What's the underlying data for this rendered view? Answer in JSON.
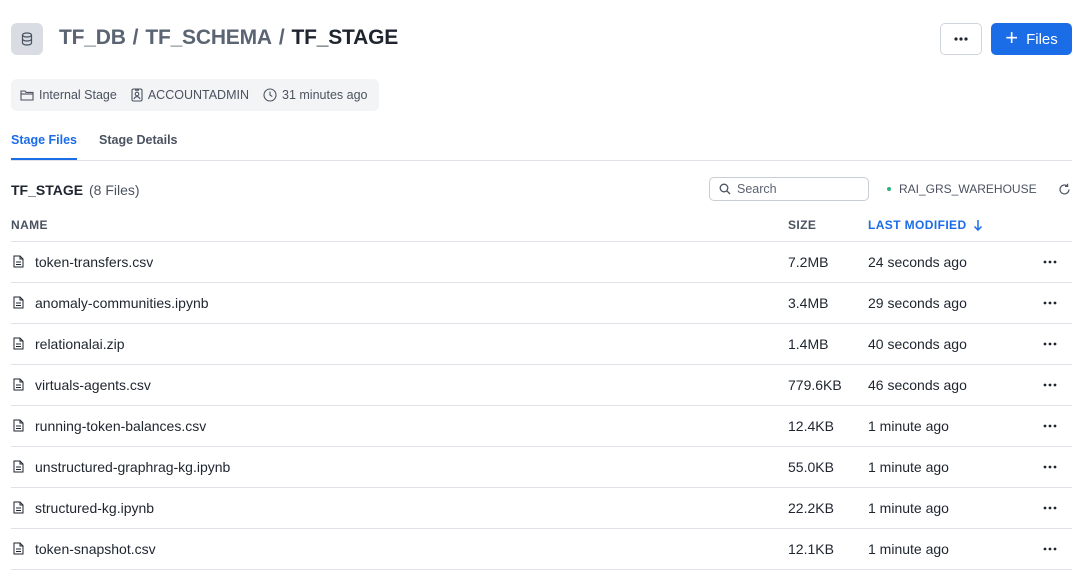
{
  "header": {
    "breadcrumb": [
      "TF_DB",
      "TF_SCHEMA",
      "TF_STAGE"
    ],
    "separator": "/",
    "files_button_label": "Files",
    "more_button_icon": "ellipsis-icon",
    "db_icon": "database-icon"
  },
  "meta": {
    "stage_type": "Internal Stage",
    "owner": "ACCOUNTADMIN",
    "created": "31 minutes ago"
  },
  "tabs": [
    {
      "label": "Stage Files",
      "active": true
    },
    {
      "label": "Stage Details",
      "active": false
    }
  ],
  "toolbar": {
    "title": "TF_STAGE",
    "count": "(8 Files)",
    "search_placeholder": "Search",
    "warehouse": "RAI_GRS_WAREHOUSE"
  },
  "table": {
    "columns": {
      "name": "NAME",
      "size": "SIZE",
      "modified": "LAST MODIFIED"
    },
    "rows": [
      {
        "name": "token-transfers.csv",
        "size": "7.2MB",
        "modified": "24 seconds ago"
      },
      {
        "name": "anomaly-communities.ipynb",
        "size": "3.4MB",
        "modified": "29 seconds ago"
      },
      {
        "name": "relationalai.zip",
        "size": "1.4MB",
        "modified": "40 seconds ago"
      },
      {
        "name": "virtuals-agents.csv",
        "size": "779.6KB",
        "modified": "46 seconds ago"
      },
      {
        "name": "running-token-balances.csv",
        "size": "12.4KB",
        "modified": "1 minute ago"
      },
      {
        "name": "unstructured-graphrag-kg.ipynb",
        "size": "55.0KB",
        "modified": "1 minute ago"
      },
      {
        "name": "structured-kg.ipynb",
        "size": "22.2KB",
        "modified": "1 minute ago"
      },
      {
        "name": "token-snapshot.csv",
        "size": "12.1KB",
        "modified": "1 minute ago"
      }
    ]
  },
  "colors": {
    "accent": "#1a6ce7",
    "status_ok": "#2fb37d",
    "text_primary": "#1e252f",
    "text_secondary": "#4a5260"
  }
}
